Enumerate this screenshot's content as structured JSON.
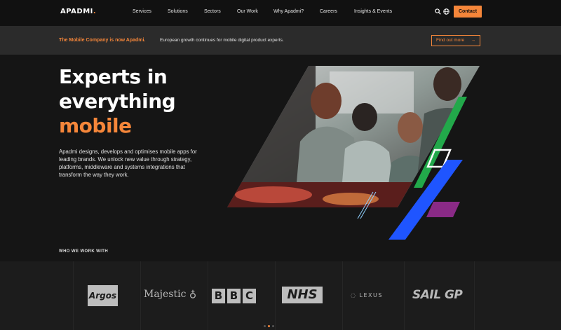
{
  "nav": {
    "logo": "APADMI",
    "logo_dot": ".",
    "items": [
      "Services",
      "Solutions",
      "Sectors",
      "Our Work",
      "Why Apadmi?",
      "Careers",
      "Insights & Events"
    ],
    "search_icon": "search-icon",
    "globe_icon": "globe-icon",
    "contact_label": "Contact"
  },
  "banner": {
    "title": "The Mobile Company is now Apadmi.",
    "text": "European growth continues for mobile digital product experts.",
    "button_label": "Find out more",
    "button_icon": "arrow-right-icon"
  },
  "hero": {
    "title_line1": "Experts in",
    "title_line2": "everything",
    "title_accent": "mobile",
    "description": "Apadmi designs, develops and optimises mobile apps for leading brands. We unlock new value through strategy, platforms, middleware and systems integrations that transform the way they work."
  },
  "clients": {
    "label": "WHO WE WORK WITH",
    "logos": [
      "Argos",
      "Majestic",
      "BBC",
      "NHS",
      "LEXUS",
      "SAIL GP"
    ]
  },
  "colors": {
    "accent": "#f5863a",
    "background": "#151515",
    "banner": "#2b2b2b",
    "green_shape": "#22a84a",
    "blue_shape": "#1f55ff",
    "magenta_shape": "#8a2a86"
  }
}
